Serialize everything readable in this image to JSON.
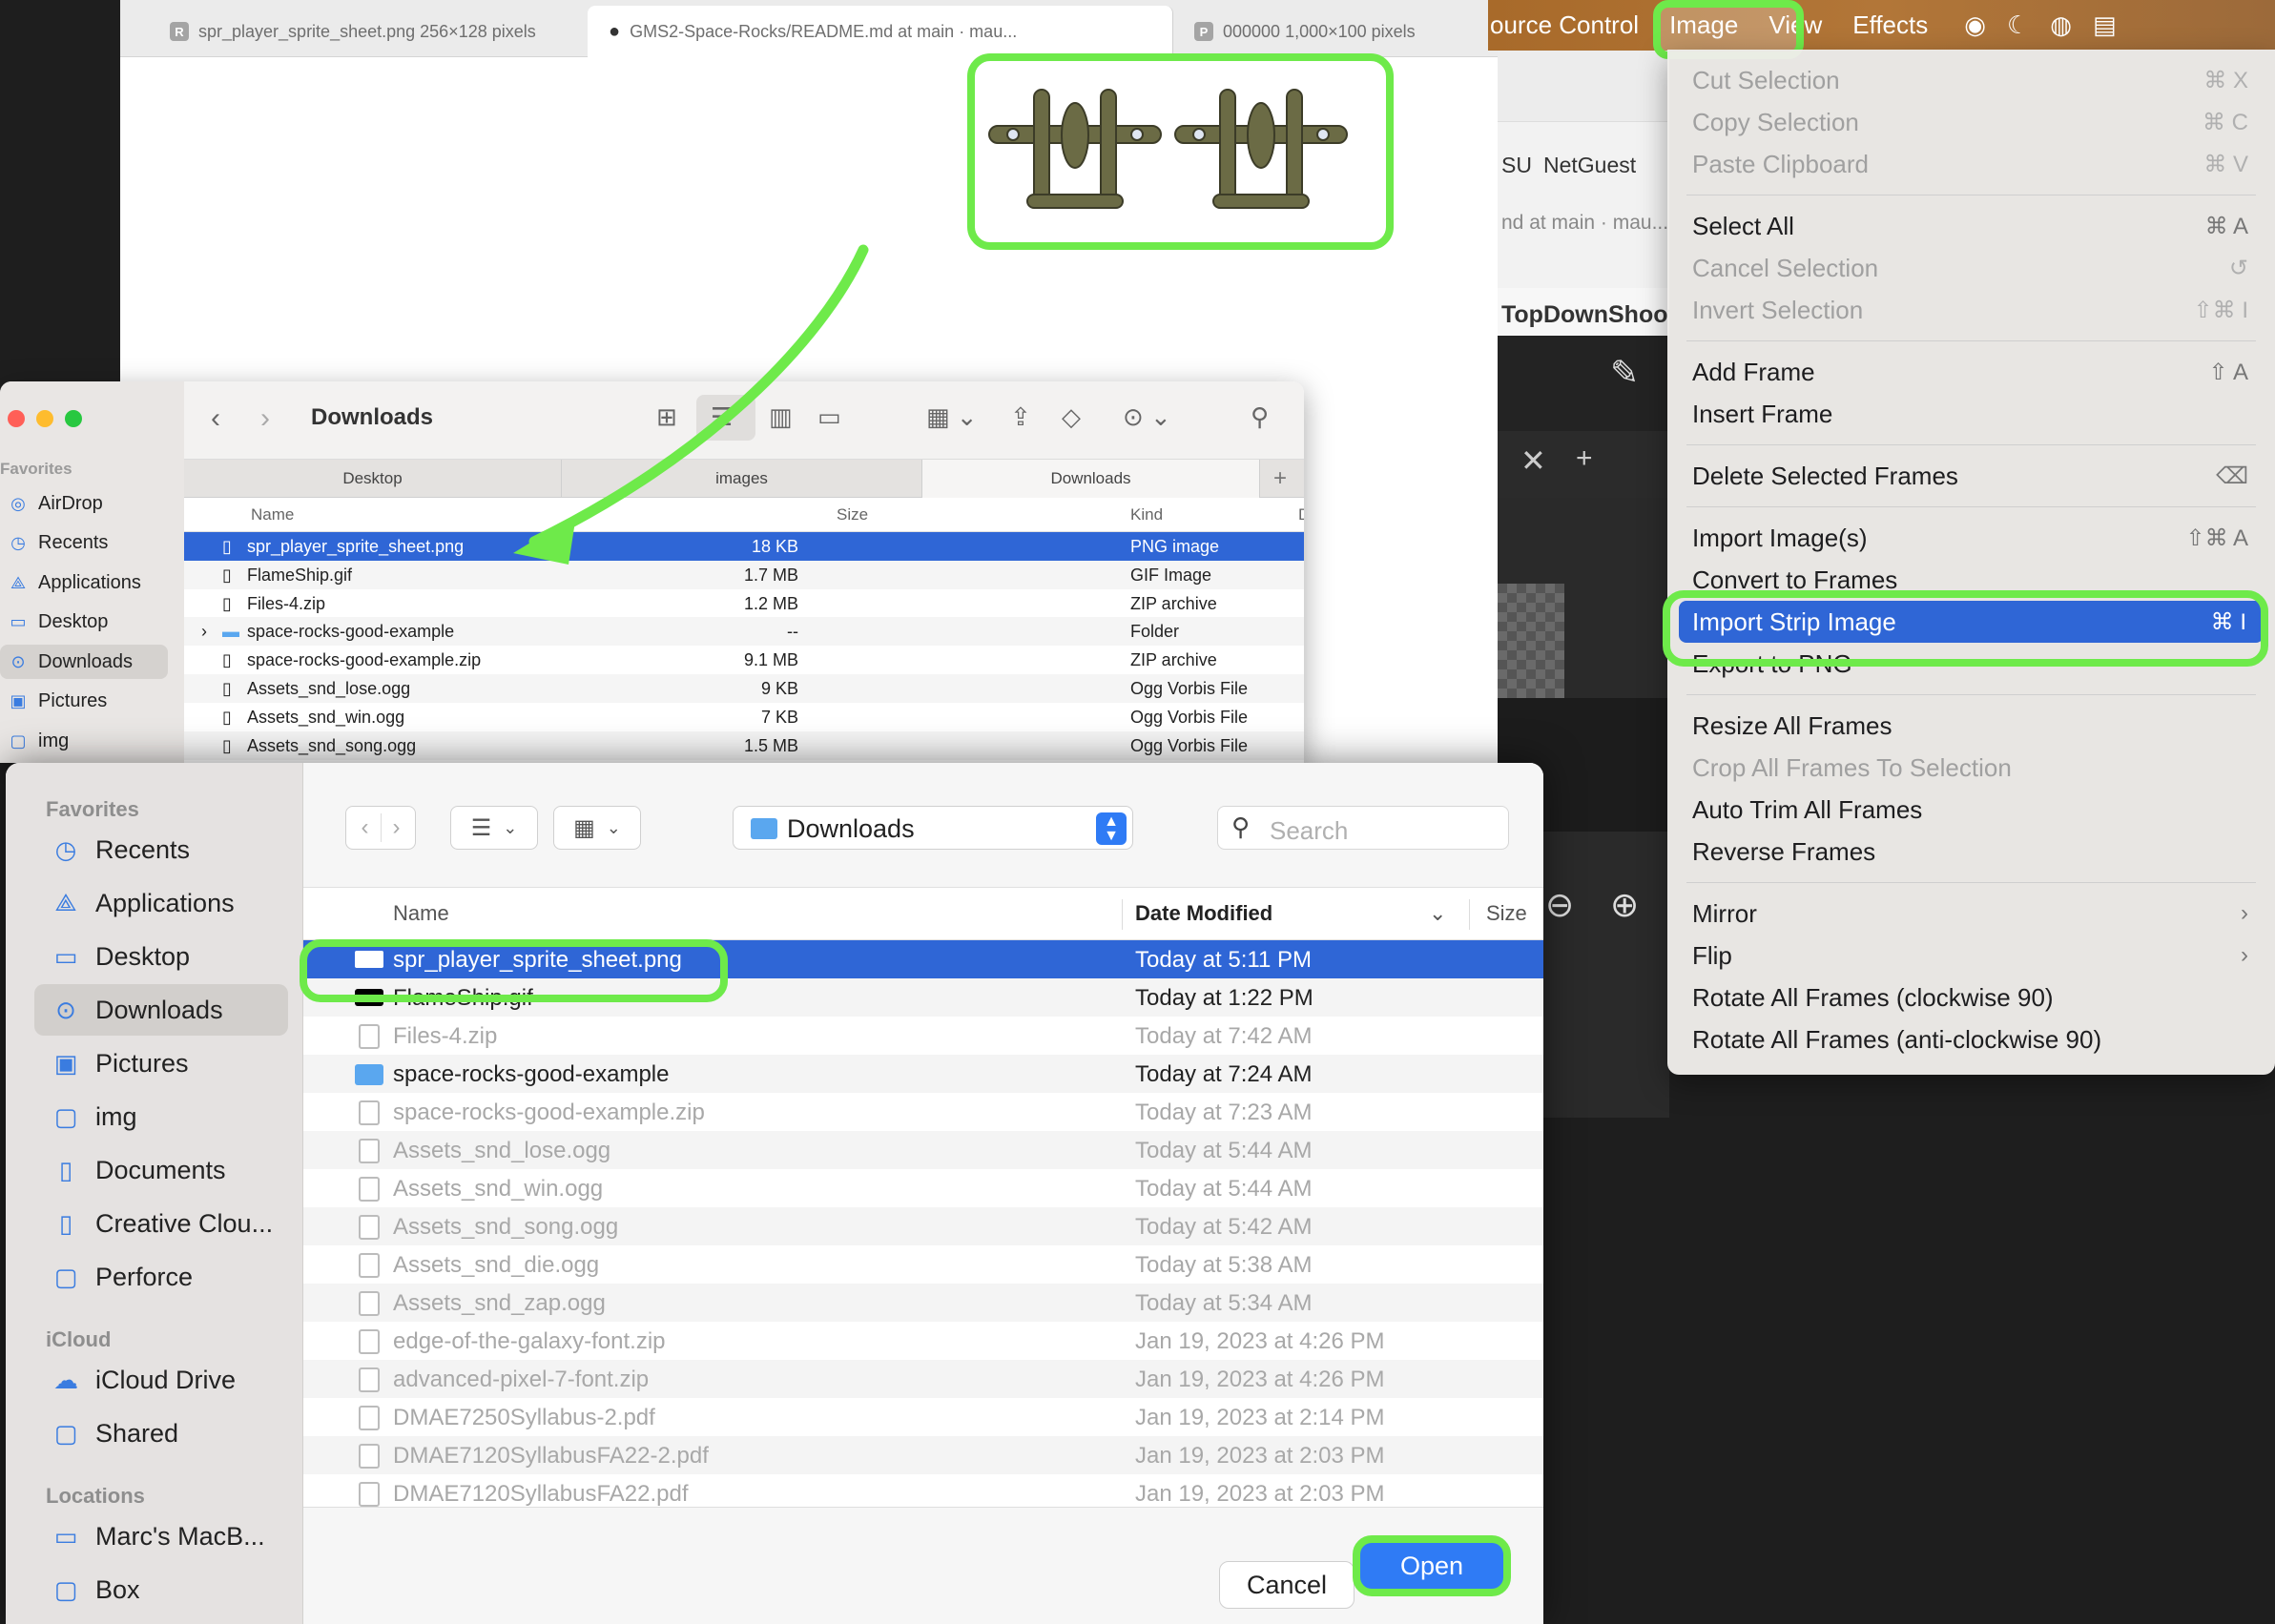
{
  "browser": {
    "tabs": [
      {
        "favicon": "R",
        "label": "spr_player_sprite_sheet.png 256×128 pixels"
      },
      {
        "favicon": "github-icon",
        "label": "GMS2-Space-Rocks/README.md at main · mau..."
      },
      {
        "favicon": "P",
        "label": "000000 1,000×100 pixels"
      }
    ]
  },
  "background_app": {
    "lines": [
      "SU",
      "NetGuest",
      "nd at main · mau...",
      "TopDownShoot"
    ]
  },
  "menubar": {
    "items": [
      "ource Control",
      "Image",
      "View",
      "Effects"
    ],
    "accent": "#6eea4a"
  },
  "image_menu": {
    "groups": [
      [
        {
          "label": "Cut Selection",
          "shortcut": "⌘ X",
          "disabled": true
        },
        {
          "label": "Copy Selection",
          "shortcut": "⌘ C",
          "disabled": true
        },
        {
          "label": "Paste Clipboard",
          "shortcut": "⌘ V",
          "disabled": true
        }
      ],
      [
        {
          "label": "Select All",
          "shortcut": "⌘ A",
          "disabled": false
        },
        {
          "label": "Cancel Selection",
          "shortcut": "↺",
          "disabled": true
        },
        {
          "label": "Invert Selection",
          "shortcut": "⇧⌘ I",
          "disabled": true
        }
      ],
      [
        {
          "label": "Add Frame",
          "shortcut": "⇧ A",
          "disabled": false
        },
        {
          "label": "Insert Frame",
          "shortcut": "",
          "disabled": false
        }
      ],
      [
        {
          "label": "Delete Selected Frames",
          "shortcut": "⌫",
          "disabled": false
        }
      ],
      [
        {
          "label": "Import Image(s)",
          "shortcut": "⇧⌘ A",
          "disabled": false
        },
        {
          "label": "Convert to Frames",
          "shortcut": "",
          "disabled": false
        },
        {
          "label": "Import Strip Image",
          "shortcut": "⌘ I",
          "disabled": false,
          "highlighted": true
        },
        {
          "label": "Export to PNG",
          "shortcut": "",
          "disabled": false
        }
      ],
      [
        {
          "label": "Resize All Frames",
          "shortcut": "",
          "disabled": false
        },
        {
          "label": "Crop All Frames To Selection",
          "shortcut": "",
          "disabled": true
        },
        {
          "label": "Auto Trim All Frames",
          "shortcut": "",
          "disabled": false
        },
        {
          "label": "Reverse Frames",
          "shortcut": "",
          "disabled": false
        }
      ],
      [
        {
          "label": "Mirror",
          "shortcut": "›",
          "disabled": false
        },
        {
          "label": "Flip",
          "shortcut": "›",
          "disabled": false
        },
        {
          "label": "Rotate All Frames (clockwise 90)",
          "shortcut": "",
          "disabled": false
        },
        {
          "label": "Rotate All Frames (anti-clockwise 90)",
          "shortcut": "",
          "disabled": false
        }
      ]
    ]
  },
  "finder": {
    "title": "Downloads",
    "sidebar_heading": "Favorites",
    "sidebar": [
      "AirDrop",
      "Recents",
      "Applications",
      "Desktop",
      "Downloads",
      "Pictures",
      "img"
    ],
    "sidebar_selected": "Downloads",
    "tabs": [
      "Desktop",
      "images",
      "Downloads"
    ],
    "active_tab": "Downloads",
    "columns": [
      "Name",
      "Size",
      "Kind",
      "D"
    ],
    "rows": [
      {
        "name": "spr_player_sprite_sheet.png",
        "size": "18 KB",
        "kind": "PNG image",
        "selected": true
      },
      {
        "name": "FlameShip.gif",
        "size": "1.7 MB",
        "kind": "GIF Image"
      },
      {
        "name": "Files-4.zip",
        "size": "1.2 MB",
        "kind": "ZIP archive"
      },
      {
        "name": "space-rocks-good-example",
        "size": "--",
        "kind": "Folder"
      },
      {
        "name": "space-rocks-good-example.zip",
        "size": "9.1 MB",
        "kind": "ZIP archive"
      },
      {
        "name": "Assets_snd_lose.ogg",
        "size": "9 KB",
        "kind": "Ogg Vorbis File"
      },
      {
        "name": "Assets_snd_win.ogg",
        "size": "7 KB",
        "kind": "Ogg Vorbis File"
      },
      {
        "name": "Assets_snd_song.ogg",
        "size": "1.5 MB",
        "kind": "Ogg Vorbis File"
      }
    ]
  },
  "dialog": {
    "sidebar": {
      "favorites_heading": "Favorites",
      "favorites": [
        "Recents",
        "Applications",
        "Desktop",
        "Downloads",
        "Pictures",
        "img",
        "Documents",
        "Creative Clou...",
        "Perforce"
      ],
      "selected": "Downloads",
      "icloud_heading": "iCloud",
      "icloud": [
        "iCloud Drive",
        "Shared"
      ],
      "locations_heading": "Locations",
      "locations": [
        "Marc's MacB...",
        "Box"
      ]
    },
    "location": "Downloads",
    "search_placeholder": "Search",
    "columns": {
      "name": "Name",
      "date": "Date Modified",
      "size": "Size"
    },
    "rows": [
      {
        "name": "spr_player_sprite_sheet.png",
        "date": "Today at 5:11 PM",
        "selected": true,
        "type": "img"
      },
      {
        "name": "FlameShip.gif",
        "date": "Today at 1:22 PM",
        "type": "gif"
      },
      {
        "name": "Files-4.zip",
        "date": "Today at 7:42 AM",
        "dim": true,
        "type": "zip"
      },
      {
        "name": "space-rocks-good-example",
        "date": "Today at 7:24 AM",
        "type": "folder"
      },
      {
        "name": "space-rocks-good-example.zip",
        "date": "Today at 7:23 AM",
        "dim": true,
        "type": "zip"
      },
      {
        "name": "Assets_snd_lose.ogg",
        "date": "Today at 5:44 AM",
        "dim": true,
        "type": "audio"
      },
      {
        "name": "Assets_snd_win.ogg",
        "date": "Today at 5:44 AM",
        "dim": true,
        "type": "audio"
      },
      {
        "name": "Assets_snd_song.ogg",
        "date": "Today at 5:42 AM",
        "dim": true,
        "type": "audio"
      },
      {
        "name": "Assets_snd_die.ogg",
        "date": "Today at 5:38 AM",
        "dim": true,
        "type": "audio"
      },
      {
        "name": "Assets_snd_zap.ogg",
        "date": "Today at 5:34 AM",
        "dim": true,
        "type": "audio"
      },
      {
        "name": "edge-of-the-galaxy-font.zip",
        "date": "Jan 19, 2023 at 4:26 PM",
        "dim": true,
        "type": "zip"
      },
      {
        "name": "advanced-pixel-7-font.zip",
        "date": "Jan 19, 2023 at 4:26 PM",
        "dim": true,
        "type": "zip"
      },
      {
        "name": "DMAE7250Syllabus-2.pdf",
        "date": "Jan 19, 2023 at 2:14 PM",
        "dim": true,
        "type": "pdf"
      },
      {
        "name": "DMAE7120SyllabusFA22-2.pdf",
        "date": "Jan 19, 2023 at 2:03 PM",
        "dim": true,
        "type": "pdf"
      },
      {
        "name": "DMAE7120SyllabusFA22.pdf",
        "date": "Jan 19, 2023 at 2:03 PM",
        "dim": true,
        "type": "pdf"
      }
    ],
    "cancel_label": "Cancel",
    "open_label": "Open"
  }
}
